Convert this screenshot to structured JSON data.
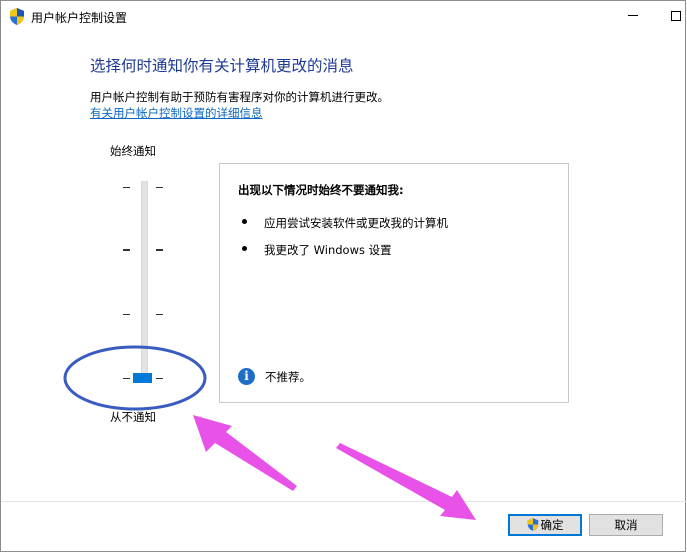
{
  "window": {
    "title": "用户帐户控制设置",
    "min_icon": "minimize-icon",
    "max_icon": "maximize-icon"
  },
  "main": {
    "heading": "选择何时通知你有关计算机更改的消息",
    "description": "用户帐户控制有助于预防有害程序对你的计算机进行更改。",
    "link": "有关用户帐户控制设置的详细信息"
  },
  "slider": {
    "top_label": "始终通知",
    "bottom_label": "从不通知",
    "levels": 4,
    "current_level": 1
  },
  "panel": {
    "title": "出现以下情况时始终不要通知我:",
    "items": [
      "应用尝试安装软件或更改我的计算机",
      "我更改了 Windows 设置"
    ],
    "info_text": "不推荐。"
  },
  "buttons": {
    "ok": "确定",
    "cancel": "取消"
  },
  "colors": {
    "heading": "#1f3a93",
    "link": "#0a66c2",
    "accent": "#0078d7",
    "annotation_ellipse": "#3a5bbf",
    "annotation_arrow": "#e63fe6"
  }
}
